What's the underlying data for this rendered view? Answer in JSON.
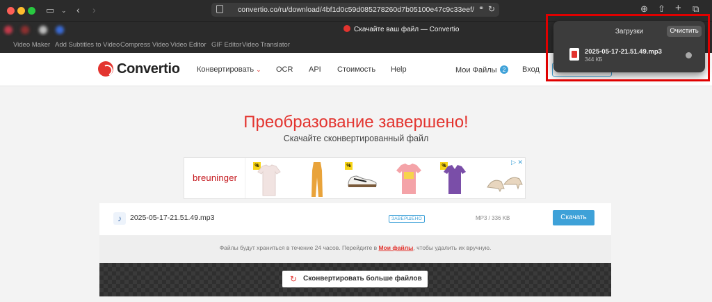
{
  "browser": {
    "url": "convertio.co/ru/download/4bf1d0c59d085278260d7b05100e47c9c33eef/",
    "tab_title": "Скачайте ваш файл — Convertio"
  },
  "site_nav": [
    "Video Maker",
    "Add Subtitles to Video",
    "Compress Video",
    "Video Editor",
    "GIF Editor",
    "Video Translator"
  ],
  "header": {
    "logo": "Convertio",
    "convert": "Конвертировать",
    "ocr": "OCR",
    "api": "API",
    "pricing": "Стоимость",
    "help": "Help",
    "my_files": "Мои Файлы",
    "my_files_count": "2",
    "login": "Вход"
  },
  "hero": {
    "title": "Преобразование завершено!",
    "subtitle": "Скачайте сконвертированный файл"
  },
  "ad": {
    "brand": "breuninger",
    "badge": "%",
    "choices_icon": "▷ ✕"
  },
  "file": {
    "name": "2025-05-17-21.51.49.mp3",
    "status": "ЗАВЕРШЕНО",
    "size": "MP3 / 336 KB",
    "download": "Скачать"
  },
  "notice": {
    "before": "Файлы будут храниться в течение 24 часов. Перейдите в ",
    "link": "Мои файлы",
    "after": ", чтобы удалить их вручную."
  },
  "convert_more": "Сконвертировать больше файлов",
  "downloads_panel": {
    "title": "Загрузки",
    "clear": "Очистить",
    "file_name": "2025-05-17-21.51.49.mp3",
    "file_size": "344 КБ"
  },
  "colors": {
    "accent_red": "#e3342f",
    "accent_blue": "#3ea1d8",
    "highlight": "#e00000"
  }
}
